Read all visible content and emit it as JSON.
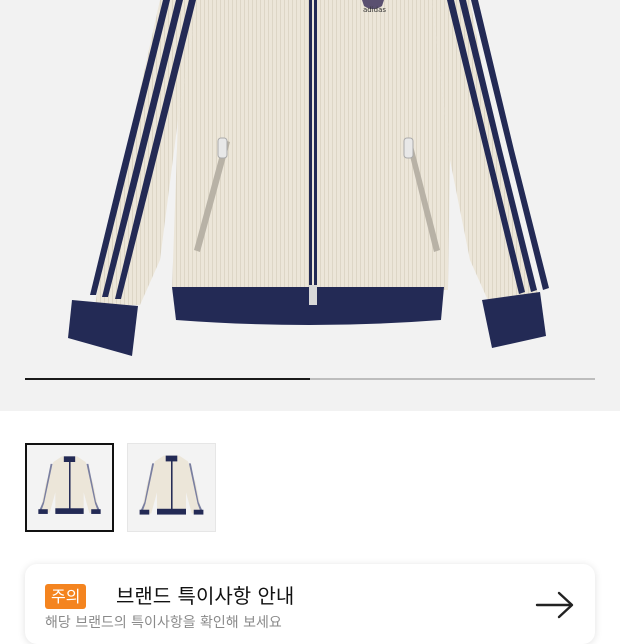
{
  "gallery": {
    "progress_fraction": 0.5,
    "logo_text": "adidas",
    "colors": {
      "body": "#ece6d9",
      "trim": "#232a55",
      "background": "#f2f2f2"
    },
    "thumbnails": [
      {
        "name": "thumb-front",
        "selected": true
      },
      {
        "name": "thumb-front-alt",
        "selected": false
      }
    ]
  },
  "notice": {
    "badge": "주의",
    "title": "브랜드 특이사항 안내",
    "subtitle": "해당 브랜드의 특이사항을 확인해 보세요",
    "arrow_icon": "arrow-right-icon",
    "badge_color": "#f4841f"
  }
}
